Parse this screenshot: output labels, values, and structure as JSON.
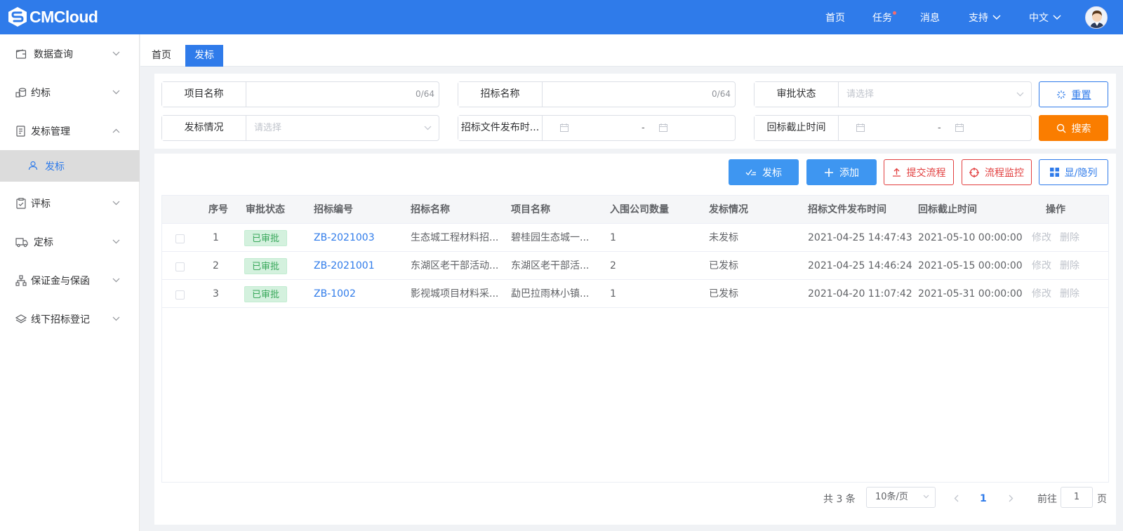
{
  "app": {
    "brand": "CMCloud"
  },
  "topnav": {
    "home": "首页",
    "tasks": "任务",
    "messages": "消息",
    "support": "支持",
    "language": "中文"
  },
  "sidebar": {
    "items": [
      {
        "label": "数据查询",
        "icon": "wallet-icon",
        "expanded": false
      },
      {
        "label": "约标",
        "icon": "coins-icon",
        "expanded": false
      },
      {
        "label": "发标管理",
        "icon": "document-list-icon",
        "expanded": true,
        "children": [
          {
            "label": "发标",
            "icon": "user-icon",
            "active": true
          }
        ]
      },
      {
        "label": "评标",
        "icon": "clipboard-check-icon",
        "expanded": false
      },
      {
        "label": "定标",
        "icon": "truck-icon",
        "expanded": false
      },
      {
        "label": "保证金与保函",
        "icon": "hierarchy-icon",
        "expanded": false
      },
      {
        "label": "线下招标登记",
        "icon": "layers-icon",
        "expanded": false
      }
    ]
  },
  "tabs": [
    {
      "label": "首页",
      "active": false
    },
    {
      "label": "发标",
      "active": true
    }
  ],
  "filters": {
    "project_name": {
      "label": "项目名称",
      "value": "",
      "counter": "0/64"
    },
    "tender_name": {
      "label": "招标名称",
      "value": "",
      "counter": "0/64"
    },
    "approval_status": {
      "label": "审批状态",
      "placeholder": "请选择"
    },
    "bid_status": {
      "label": "发标情况",
      "placeholder": "请选择"
    },
    "doc_publish_time": {
      "label": "招标文件发布时...",
      "separator": "-"
    },
    "deadline": {
      "label": "回标截止时间",
      "separator": "-"
    },
    "reset_label": "重置",
    "search_label": "搜索"
  },
  "toolbar": {
    "publish_label": "发标",
    "add_label": "添加",
    "submit_flow_label": "提交流程",
    "monitor_flow_label": "流程监控",
    "columns_label": "显/隐列"
  },
  "table": {
    "headers": [
      "序号",
      "审批状态",
      "招标编号",
      "招标名称",
      "项目名称",
      "入围公司数量",
      "发标情况",
      "招标文件发布时间",
      "回标截止时间",
      "操作"
    ],
    "rows": [
      {
        "index": "1",
        "approval": "已审批",
        "code": "ZB-2021003",
        "tender_name": "生态城工程材料招...",
        "project_name": "碧桂园生态城一...",
        "count": "1",
        "bid_status": "未发标",
        "publish_time": "2021-04-25 14:47:43",
        "deadline": "2021-05-10 00:00:00",
        "edit": "修改",
        "delete": "删除"
      },
      {
        "index": "2",
        "approval": "已审批",
        "code": "ZB-2021001",
        "tender_name": "东湖区老干部活动...",
        "project_name": "东湖区老干部活...",
        "count": "2",
        "bid_status": "已发标",
        "publish_time": "2021-04-25 14:46:24",
        "deadline": "2021-05-15 00:00:00",
        "edit": "修改",
        "delete": "删除"
      },
      {
        "index": "3",
        "approval": "已审批",
        "code": "ZB-1002",
        "tender_name": "影视城项目材料采...",
        "project_name": "勐巴拉雨林小镇...",
        "count": "1",
        "bid_status": "已发标",
        "publish_time": "2021-04-20 11:07:42",
        "deadline": "2021-05-31 00:00:00",
        "edit": "修改",
        "delete": "删除"
      }
    ]
  },
  "pagination": {
    "total": "共 3 条",
    "page_size": "10条/页",
    "current_page": "1",
    "goto_prefix": "前往",
    "goto_value": "1",
    "goto_suffix": "页"
  },
  "colors": {
    "primary": "#2f7bea",
    "orange": "#fa7d00",
    "danger": "#e23f3f",
    "success": "#39a85b"
  }
}
